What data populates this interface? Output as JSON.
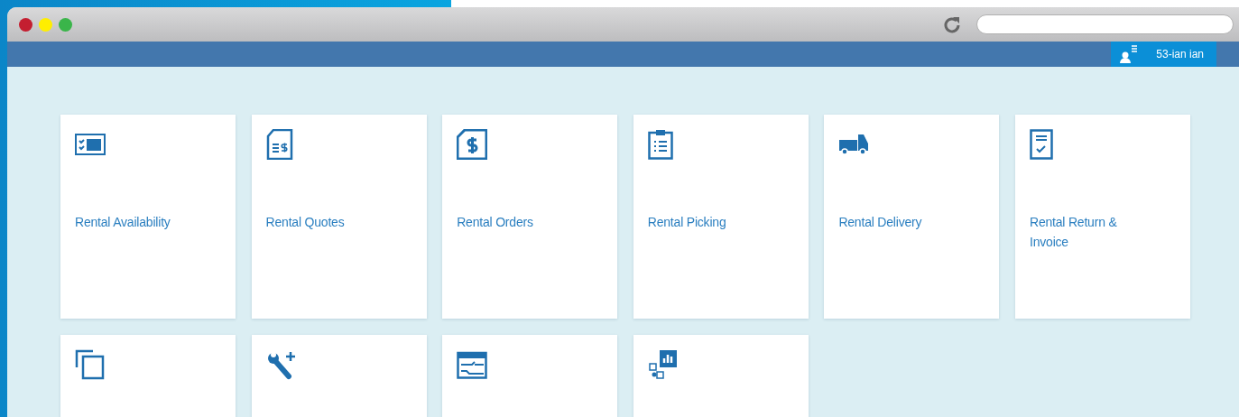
{
  "header": {
    "user_name": "53-ian ian"
  },
  "tiles": [
    {
      "kind": "availability",
      "label": "Rental Availability"
    },
    {
      "kind": "quotes",
      "label": "Rental Quotes"
    },
    {
      "kind": "orders",
      "label": "Rental Orders"
    },
    {
      "kind": "picking",
      "label": "Rental Picking"
    },
    {
      "kind": "delivery",
      "label": "Rental Delivery"
    },
    {
      "kind": "return",
      "label": "Rental Return & Invoice"
    },
    {
      "kind": "copies"
    },
    {
      "kind": "tools"
    },
    {
      "kind": "schedule"
    },
    {
      "kind": "analytics"
    }
  ]
}
